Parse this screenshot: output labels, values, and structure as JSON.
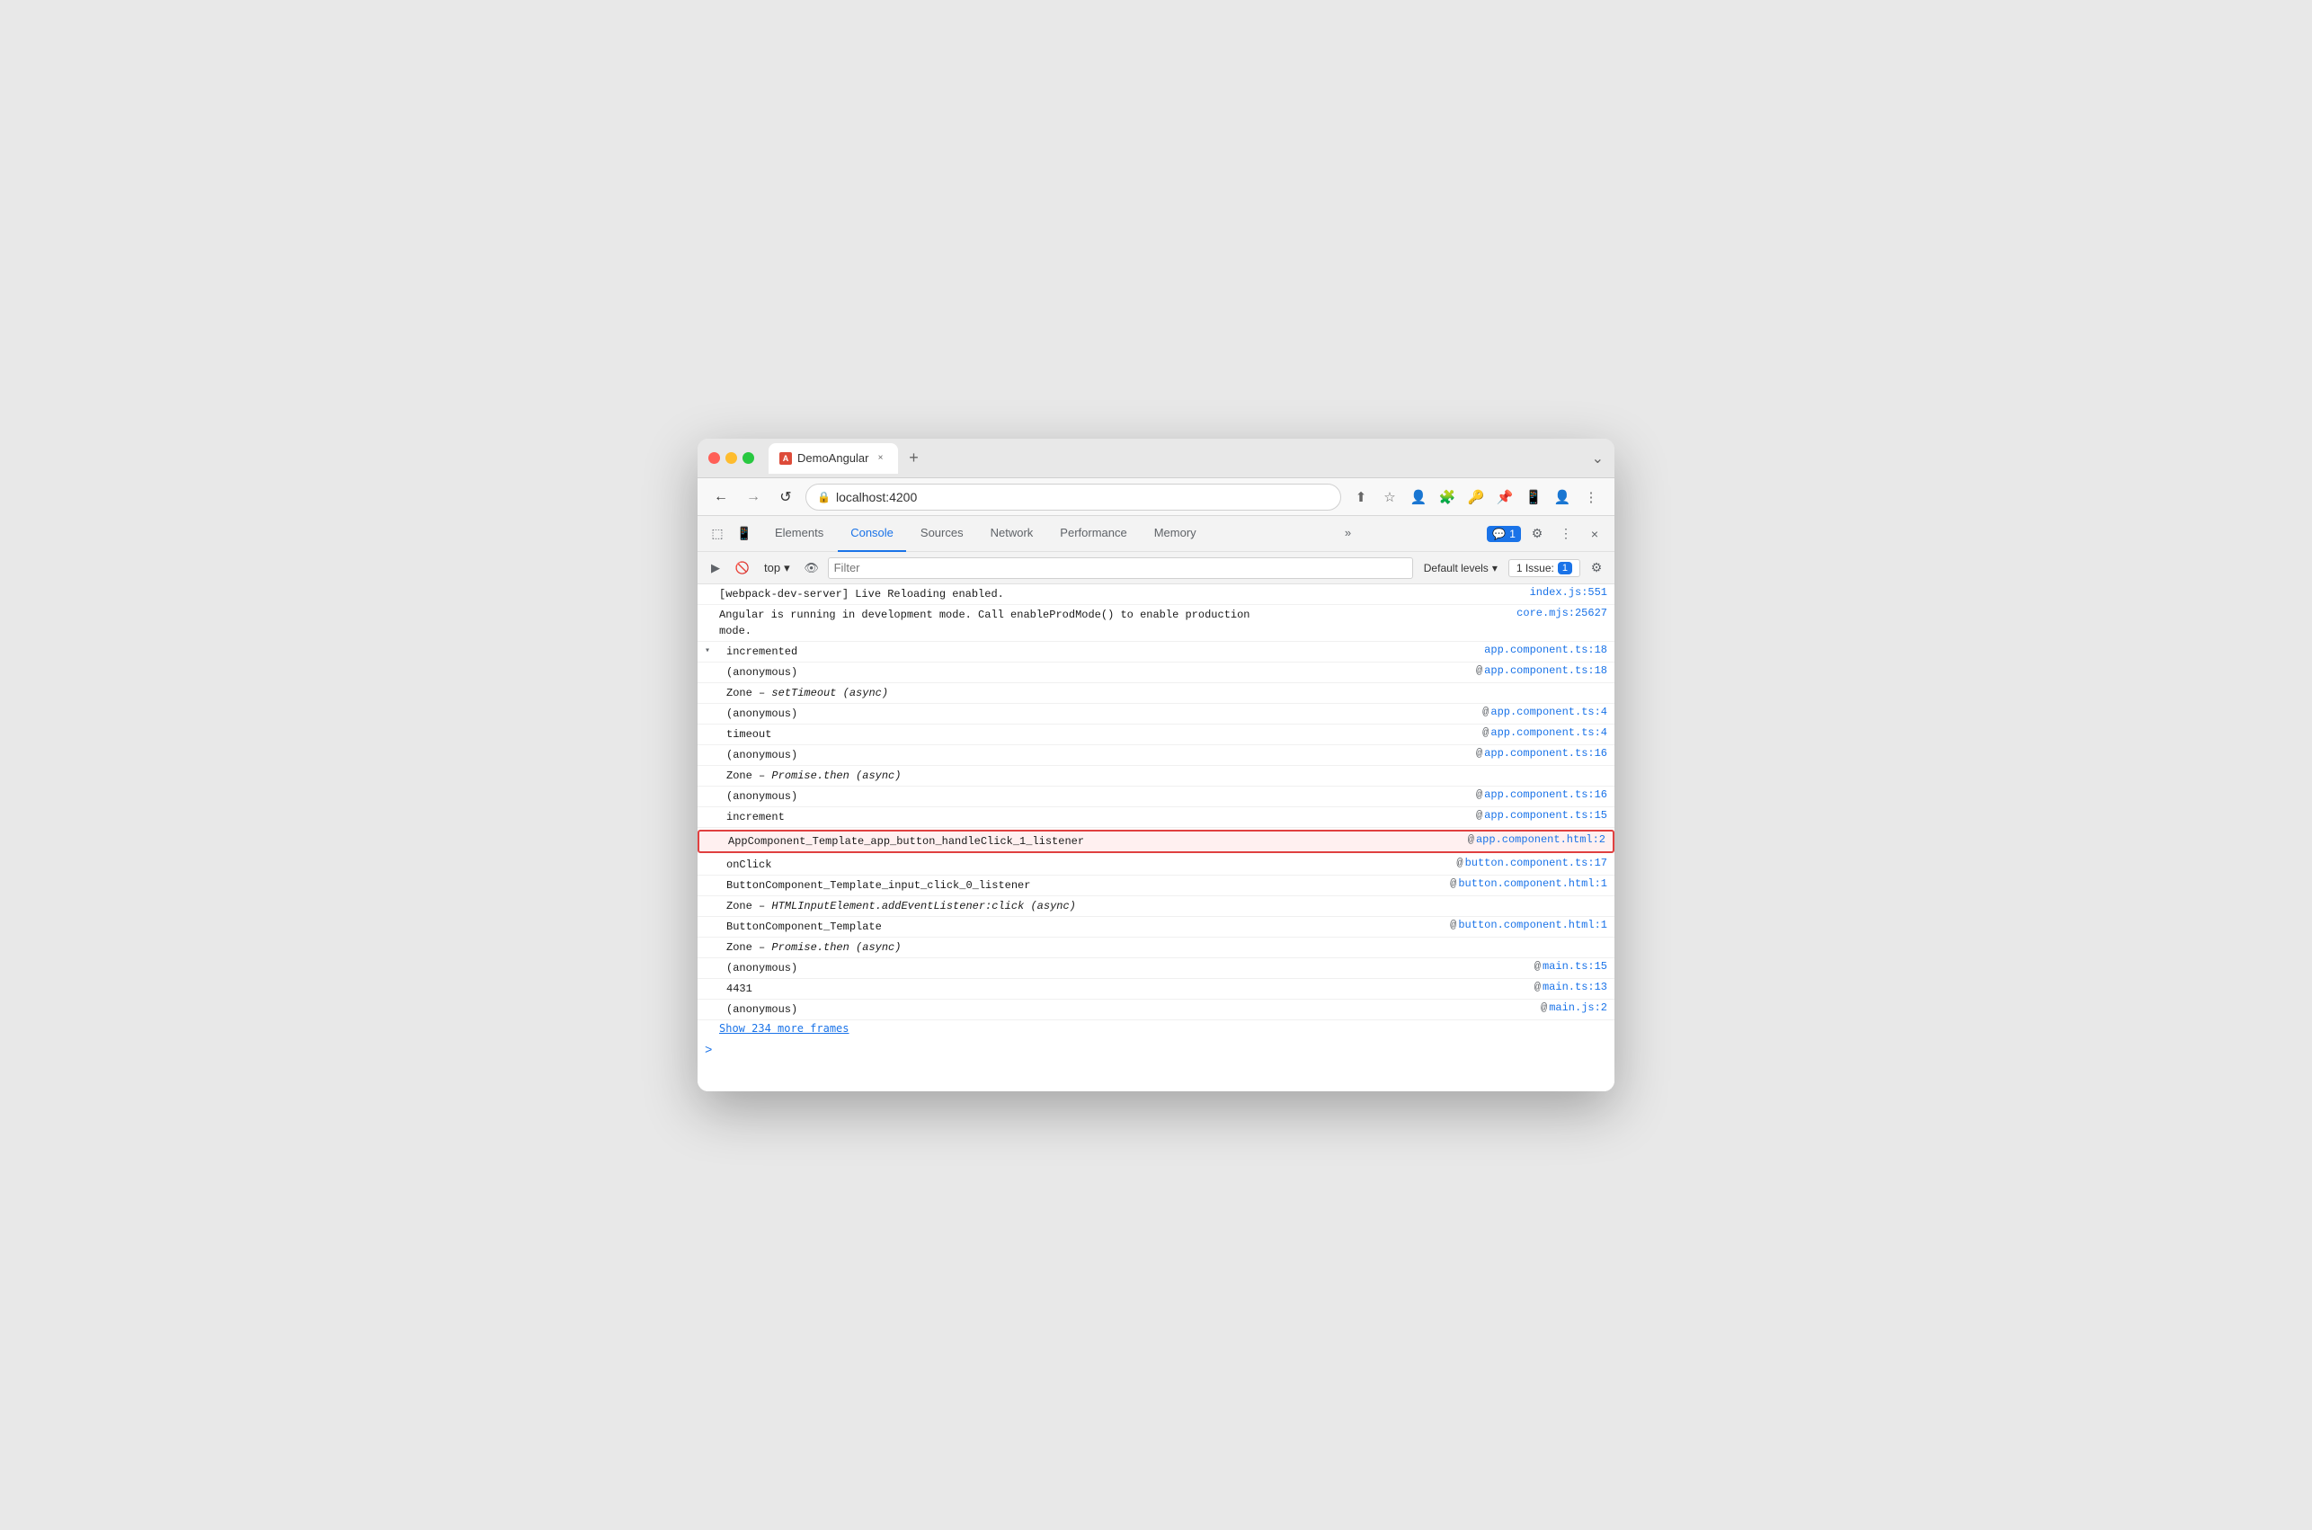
{
  "browser": {
    "title": "DemoAngular",
    "url": "localhost:4200",
    "tab_close": "×",
    "tab_new": "+",
    "tab_end": "⌄"
  },
  "nav": {
    "back": "←",
    "forward": "→",
    "refresh": "↺",
    "url": "localhost:4200"
  },
  "devtools": {
    "tabs": [
      "Elements",
      "Console",
      "Sources",
      "Network",
      "Performance",
      "Memory"
    ],
    "active_tab": "Console",
    "badge_count": "1",
    "settings_label": "⚙",
    "close_label": "×",
    "more_label": "»",
    "kebab_label": "⋮"
  },
  "toolbar": {
    "execute_label": "▶",
    "clear_label": "🚫",
    "context": "top",
    "context_arrow": "▾",
    "eye_label": "👁",
    "filter_placeholder": "Filter",
    "default_levels": "Default levels",
    "default_levels_arrow": "▾",
    "issues_label": "1 Issue:",
    "issues_count": "1",
    "gear_label": "⚙"
  },
  "console_lines": [
    {
      "id": 1,
      "text": "[webpack-dev-server] Live Reloading enabled.",
      "source": "index.js:551",
      "indent": 0,
      "is_link": true,
      "highlighted": false,
      "has_expand": false
    },
    {
      "id": 2,
      "text": "Angular is running in development mode. Call enableProdMode() to enable production mode.",
      "source": "core.mjs:25627",
      "indent": 0,
      "is_link": true,
      "highlighted": false,
      "has_expand": false,
      "multiline": true
    },
    {
      "id": 3,
      "text": "▾ incremented",
      "source": "app.component.ts:18",
      "indent": 0,
      "is_link": true,
      "highlighted": false,
      "has_expand": true,
      "expand_char": "▾"
    },
    {
      "id": 4,
      "text": "(anonymous)",
      "source": "app.component.ts:18",
      "indent": 1,
      "is_link": true,
      "highlighted": false,
      "has_expand": false,
      "at_sign": true
    },
    {
      "id": 5,
      "text": "Zone – setTimeout (async)",
      "indent": 1,
      "highlighted": false,
      "has_expand": false,
      "is_link": false
    },
    {
      "id": 6,
      "text": "(anonymous)",
      "source": "app.component.ts:4",
      "indent": 1,
      "is_link": true,
      "highlighted": false,
      "has_expand": false,
      "at_sign": true
    },
    {
      "id": 7,
      "text": "timeout",
      "source": "app.component.ts:4",
      "indent": 1,
      "is_link": true,
      "highlighted": false,
      "has_expand": false,
      "at_sign": true
    },
    {
      "id": 8,
      "text": "(anonymous)",
      "source": "app.component.ts:16",
      "indent": 1,
      "is_link": true,
      "highlighted": false,
      "has_expand": false,
      "at_sign": true
    },
    {
      "id": 9,
      "text": "Zone – Promise.then (async)",
      "indent": 1,
      "highlighted": false,
      "has_expand": false,
      "is_link": false
    },
    {
      "id": 10,
      "text": "(anonymous)",
      "source": "app.component.ts:16",
      "indent": 1,
      "is_link": true,
      "highlighted": false,
      "has_expand": false,
      "at_sign": true
    },
    {
      "id": 11,
      "text": "increment",
      "source": "app.component.ts:15",
      "indent": 1,
      "is_link": true,
      "highlighted": false,
      "has_expand": false,
      "at_sign": true
    },
    {
      "id": 12,
      "text": "AppComponent_Template_app_button_handleClick_1_listener",
      "source": "app.component.html:2",
      "indent": 1,
      "is_link": true,
      "highlighted": true,
      "has_expand": false,
      "at_sign": true
    },
    {
      "id": 13,
      "text": "onClick",
      "source": "button.component.ts:17",
      "indent": 1,
      "is_link": true,
      "highlighted": false,
      "has_expand": false,
      "at_sign": true
    },
    {
      "id": 14,
      "text": "ButtonComponent_Template_input_click_0_listener",
      "source": "button.component.html:1",
      "indent": 1,
      "is_link": true,
      "highlighted": false,
      "has_expand": false,
      "at_sign": true
    },
    {
      "id": 15,
      "text": "Zone – HTMLInputElement.addEventListener:click (async)",
      "indent": 1,
      "highlighted": false,
      "has_expand": false,
      "is_link": false
    },
    {
      "id": 16,
      "text": "ButtonComponent_Template",
      "source": "button.component.html:1",
      "indent": 1,
      "is_link": true,
      "highlighted": false,
      "has_expand": false,
      "at_sign": true
    },
    {
      "id": 17,
      "text": "Zone – Promise.then (async)",
      "indent": 1,
      "highlighted": false,
      "has_expand": false,
      "is_link": false
    },
    {
      "id": 18,
      "text": "(anonymous)",
      "source": "main.ts:15",
      "indent": 1,
      "is_link": true,
      "highlighted": false,
      "has_expand": false,
      "at_sign": true
    },
    {
      "id": 19,
      "text": "4431",
      "source": "main.ts:13",
      "indent": 1,
      "is_link": true,
      "highlighted": false,
      "has_expand": false,
      "at_sign": true
    },
    {
      "id": 20,
      "text": "(anonymous)",
      "source": "main.js:2",
      "indent": 1,
      "is_link": true,
      "highlighted": false,
      "has_expand": false,
      "at_sign": true
    }
  ],
  "show_more": "Show 234 more frames",
  "prompt_arrow": ">"
}
